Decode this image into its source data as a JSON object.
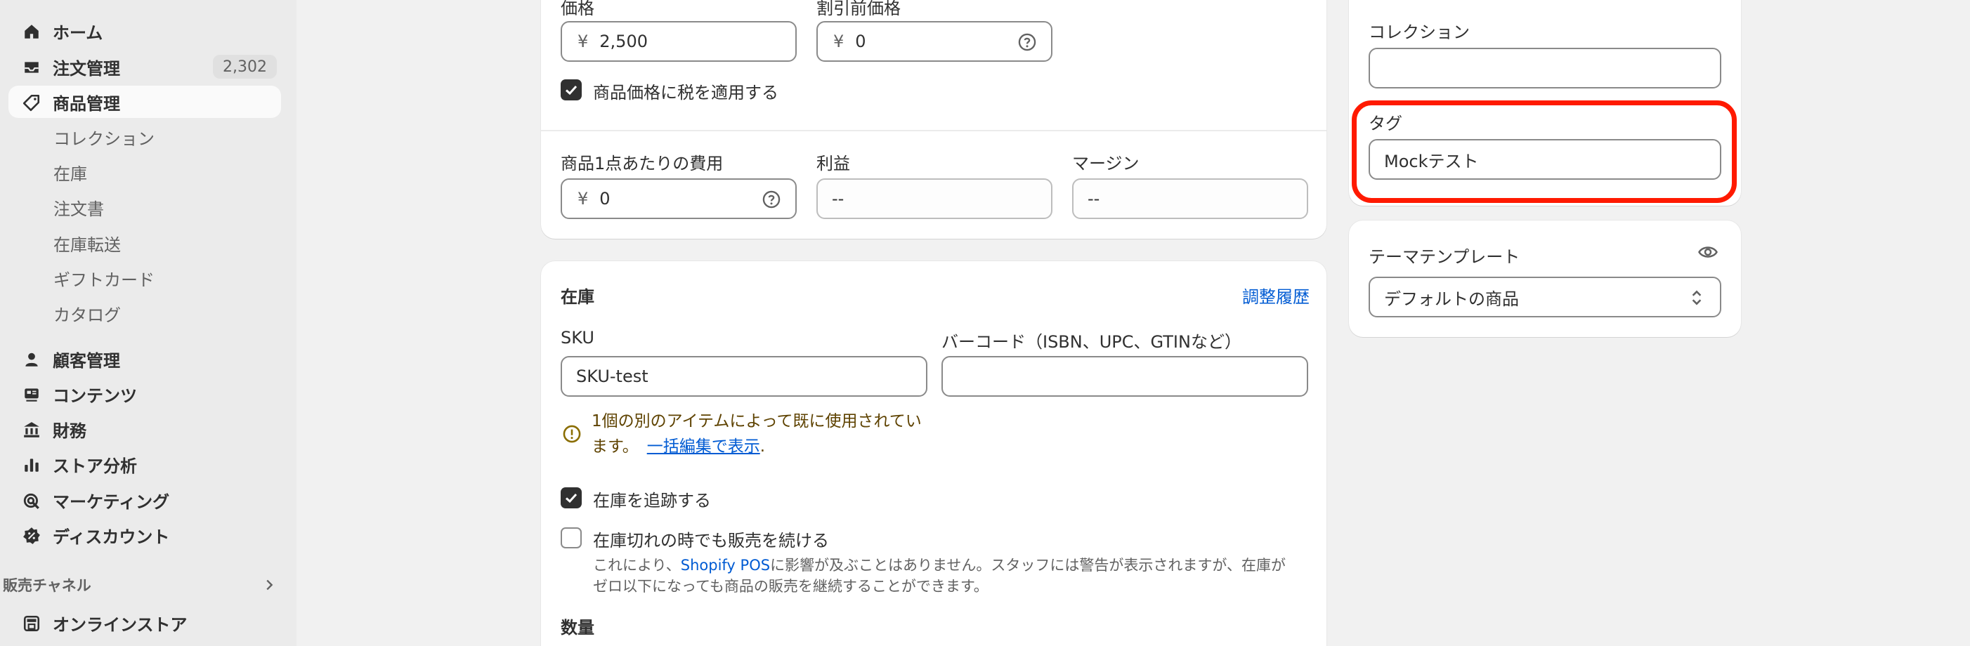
{
  "sidebar": {
    "items": [
      {
        "label": "ホーム",
        "icon": "home-icon"
      },
      {
        "label": "注文管理",
        "icon": "inbox-icon",
        "badge": "2,302"
      },
      {
        "label": "商品管理",
        "icon": "tag-icon",
        "active": true
      }
    ],
    "sub_items": [
      "コレクション",
      "在庫",
      "注文書",
      "在庫転送",
      "ギフトカード",
      "カタログ"
    ],
    "items2": [
      {
        "label": "顧客管理",
        "icon": "person-icon"
      },
      {
        "label": "コンテンツ",
        "icon": "content-icon"
      },
      {
        "label": "財務",
        "icon": "bank-icon"
      },
      {
        "label": "ストア分析",
        "icon": "bar-chart-icon"
      },
      {
        "label": "マーケティング",
        "icon": "target-icon"
      },
      {
        "label": "ディスカウント",
        "icon": "discount-icon"
      }
    ],
    "sales_channel_title": "販売チャネル",
    "online_store": "オンラインストア"
  },
  "pricing": {
    "price_label": "価格",
    "price_prefix": "¥",
    "price_value": "2,500",
    "compare_label": "割引前価格",
    "compare_prefix": "¥",
    "compare_value": "0",
    "tax_label": "商品価格に税を適用する",
    "cost_label": "商品1点あたりの費用",
    "cost_prefix": "¥",
    "cost_value": "0",
    "profit_label": "利益",
    "profit_value": "--",
    "margin_label": "マージン",
    "margin_value": "--"
  },
  "inventory": {
    "title": "在庫",
    "history_link": "調整履歴",
    "sku_label": "SKU",
    "sku_value": "SKU-test",
    "barcode_label": "バーコード（ISBN、UPC、GTINなど）",
    "barcode_value": "",
    "warning_line1": "1個の別のアイテムによって既に使用されてい",
    "warning_line2": "ます。",
    "warning_link": "一括編集で表示",
    "warning_end": ".",
    "track_label": "在庫を追跡する",
    "continue_label": "在庫切れの時でも販売を続ける",
    "help_prefix": "これにより、",
    "help_link": "Shopify POS",
    "help_suffix": "に影響が及ぶことはありません。スタッフには警告が表示されますが、在庫が",
    "help_line2": "ゼロ以下になっても商品の販売を継続することができます。",
    "quantity_label": "数量"
  },
  "organization": {
    "collection_label": "コレクション",
    "collection_value": "",
    "tags_label": "タグ",
    "tags_value": "Mockテスト"
  },
  "theme": {
    "title": "テーマテンプレート",
    "selected": "デフォルトの商品"
  },
  "colors": {
    "highlight": "#ff1a00",
    "link": "#005bd3",
    "sidebar_bg": "#ebebeb",
    "page_bg": "#f1f1f1"
  }
}
